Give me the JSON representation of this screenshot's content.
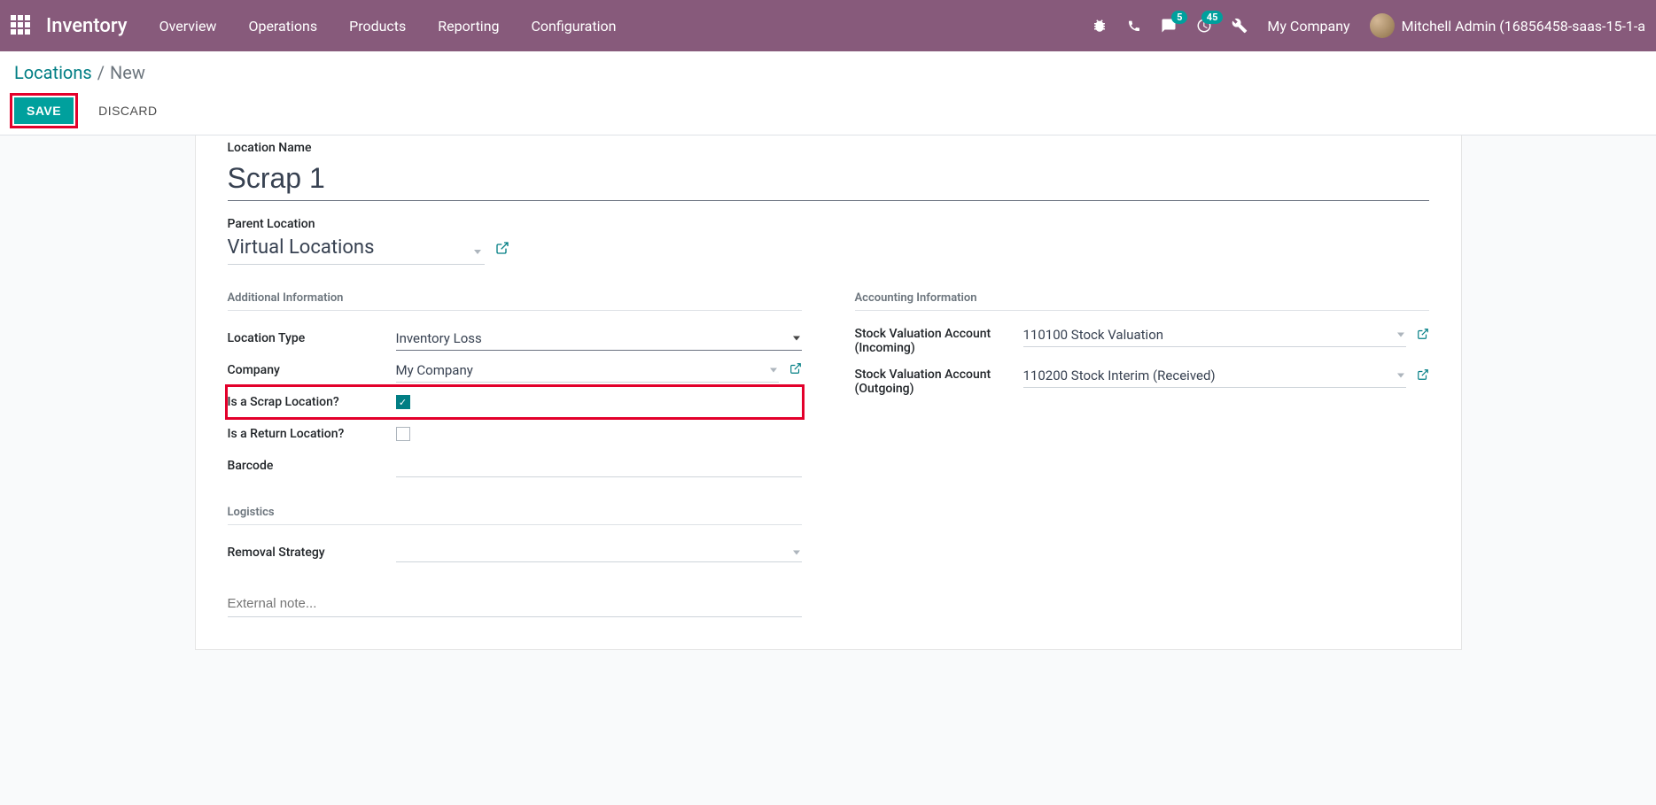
{
  "topnav": {
    "brand": "Inventory",
    "menu": [
      "Overview",
      "Operations",
      "Products",
      "Reporting",
      "Configuration"
    ],
    "badge_chat": "5",
    "badge_activity": "45",
    "company": "My Company",
    "user": "Mitchell Admin (16856458-saas-15-1-a"
  },
  "breadcrumb": {
    "root": "Locations",
    "current": "New"
  },
  "buttons": {
    "save": "SAVE",
    "discard": "DISCARD"
  },
  "form": {
    "location_name_label": "Location Name",
    "location_name_value": "Scrap 1",
    "parent_location_label": "Parent Location",
    "parent_location_value": "Virtual Locations",
    "section_additional": "Additional Information",
    "location_type_label": "Location Type",
    "location_type_value": "Inventory Loss",
    "company_label": "Company",
    "company_value": "My Company",
    "scrap_label": "Is a Scrap Location?",
    "return_label": "Is a Return Location?",
    "barcode_label": "Barcode",
    "section_logistics": "Logistics",
    "removal_label": "Removal Strategy",
    "external_note_placeholder": "External note...",
    "section_accounting": "Accounting Information",
    "sva_in_label": "Stock Valuation Account (Incoming)",
    "sva_in_value": "110100 Stock Valuation",
    "sva_out_label": "Stock Valuation Account (Outgoing)",
    "sva_out_value": "110200 Stock Interim (Received)"
  }
}
